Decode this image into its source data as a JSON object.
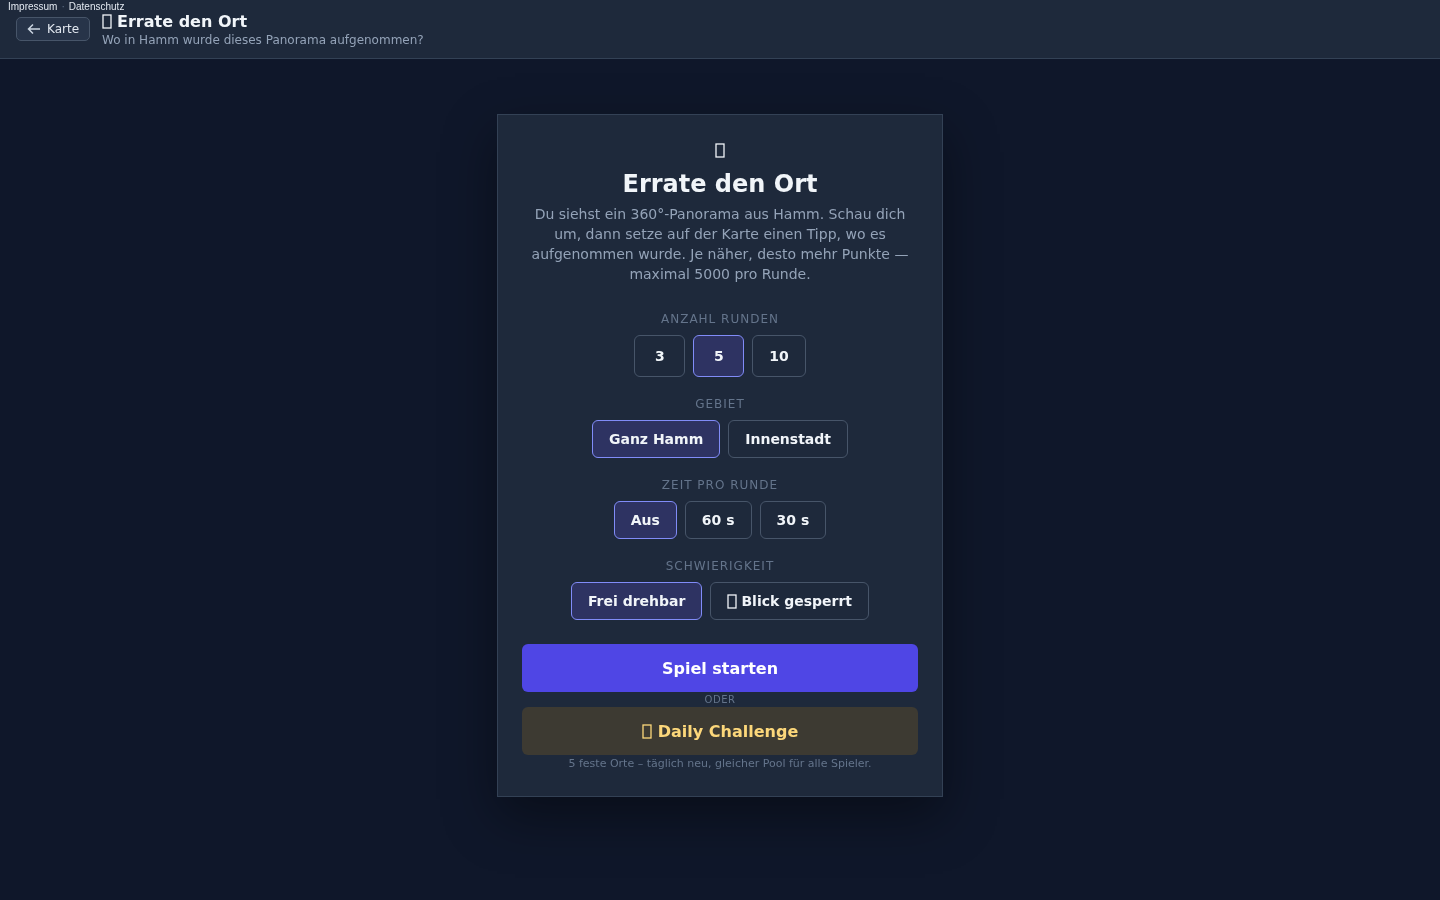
{
  "top_links": {
    "items": [
      "Impressum",
      "Datenschutz"
    ],
    "separator": "·"
  },
  "header": {
    "back_button": "Karte",
    "title": "Errate den Ort",
    "subtitle": "Wo in Hamm wurde dieses Panorama aufgenommen?"
  },
  "card": {
    "title": "Errate den Ort",
    "description": "Du siehst ein 360°-Panorama aus Hamm. Schau dich um, dann setze auf der Karte einen Tipp, wo es aufgenommen wurde. Je näher, desto mehr Punkte — maximal 5000 pro Runde.",
    "groups": [
      {
        "label": "ANZAHL RUNDEN",
        "options": [
          {
            "label": "3",
            "selected": false,
            "icon": false
          },
          {
            "label": "5",
            "selected": true,
            "icon": false
          },
          {
            "label": "10",
            "selected": false,
            "icon": false
          }
        ]
      },
      {
        "label": "GEBIET",
        "options": [
          {
            "label": "Ganz Hamm",
            "selected": true,
            "icon": false
          },
          {
            "label": "Innenstadt",
            "selected": false,
            "icon": false
          }
        ]
      },
      {
        "label": "ZEIT PRO RUNDE",
        "options": [
          {
            "label": "Aus",
            "selected": true,
            "icon": false
          },
          {
            "label": "60 s",
            "selected": false,
            "icon": false
          },
          {
            "label": "30 s",
            "selected": false,
            "icon": false
          }
        ]
      },
      {
        "label": "SCHWIERIGKEIT",
        "options": [
          {
            "label": "Frei drehbar",
            "selected": true,
            "icon": false
          },
          {
            "label": "Blick gesperrt",
            "selected": false,
            "icon": true
          }
        ]
      }
    ],
    "start_button": "Spiel starten",
    "divider_text": "ODER",
    "daily_button": "Daily Challenge",
    "daily_note": "5 feste Orte – täglich neu, gleicher Pool für alle Spieler."
  }
}
